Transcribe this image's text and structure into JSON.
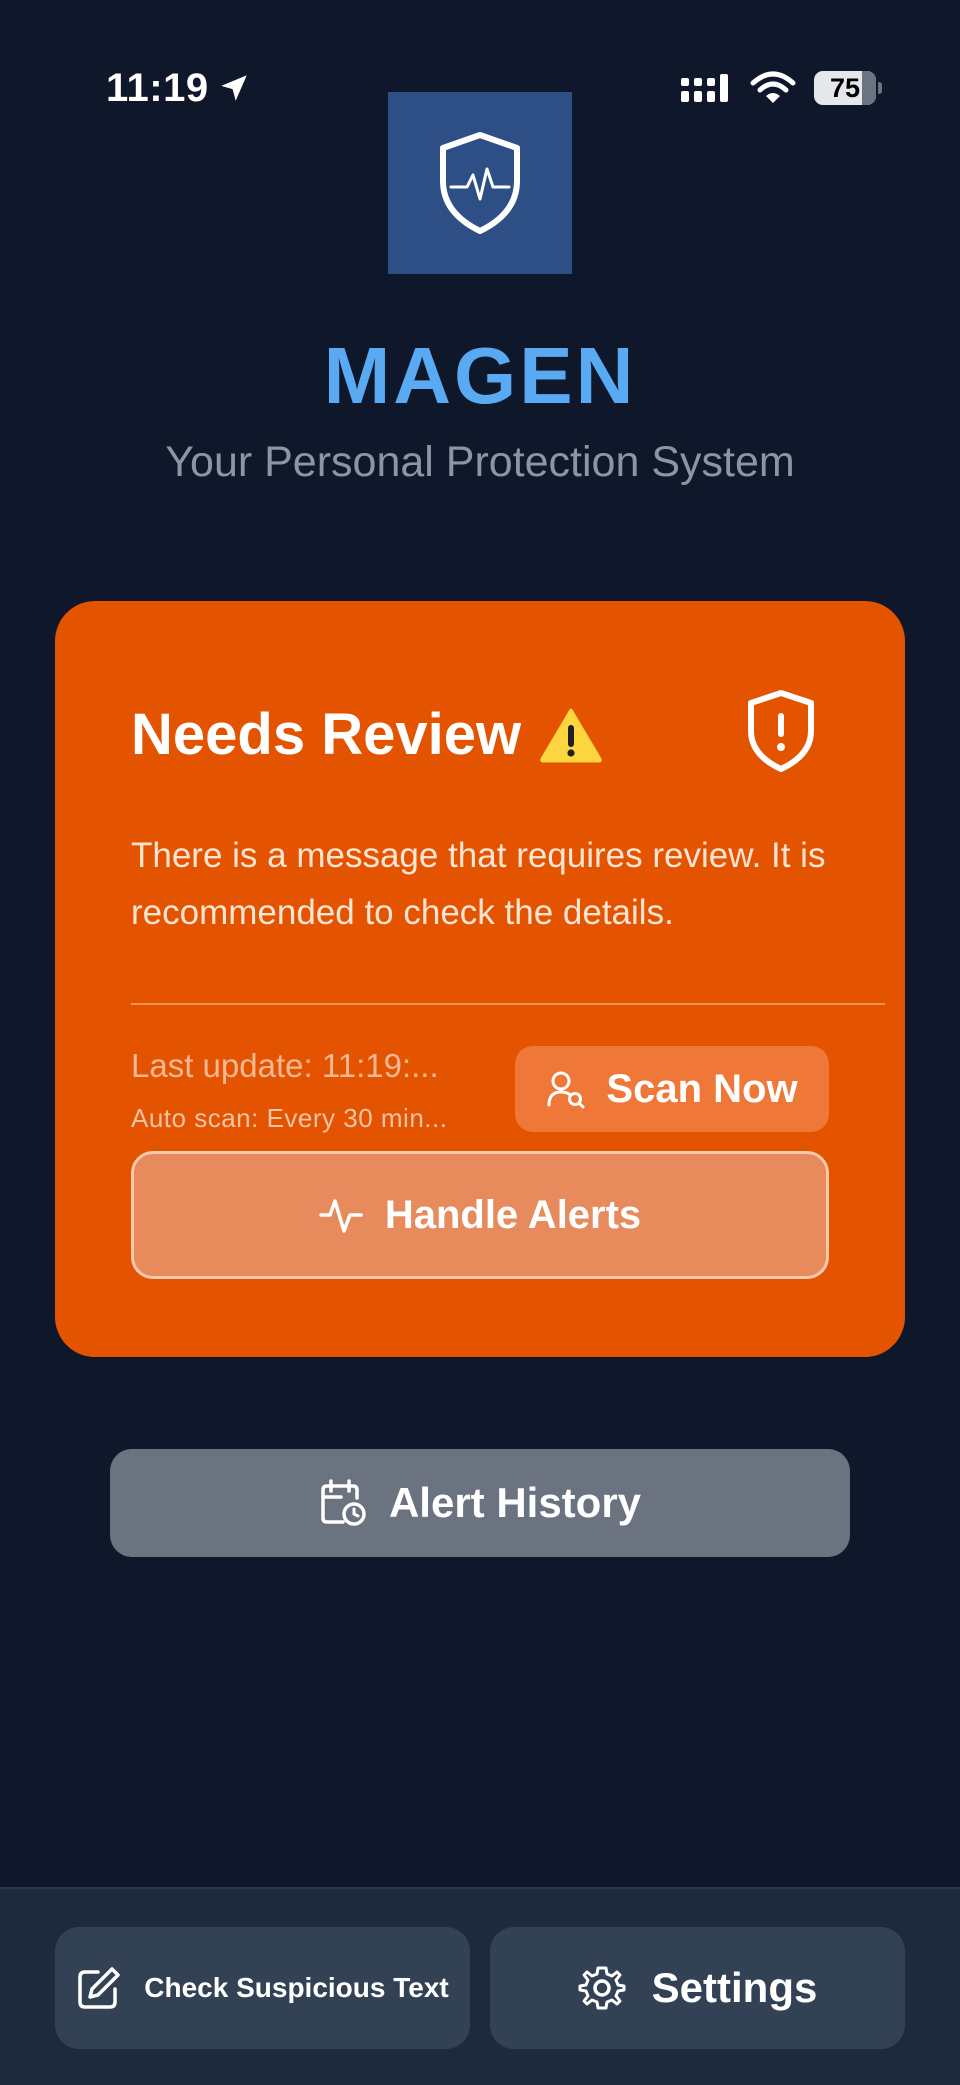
{
  "status_bar": {
    "time": "11:19",
    "battery_level": "75",
    "icons": [
      "location-arrow-icon",
      "cellular-signal-icon",
      "wifi-icon",
      "battery-icon"
    ]
  },
  "header": {
    "logo_icon": "shield-heartbeat-icon",
    "title": "MAGEN",
    "subtitle": "Your Personal Protection System"
  },
  "status_card": {
    "title": "Needs Review",
    "title_emoji": "⚠️",
    "description": "There is a message that requires review. It is recommended to check the details.",
    "last_update": "Last update: 11:19:...",
    "auto_scan": "Auto scan: Every 30 min...",
    "scan_label": "Scan Now",
    "handle_label": "Handle Alerts",
    "colors": {
      "background": "#e35300",
      "scan_button": "#ef7838",
      "handle_button": "#e78a5c"
    }
  },
  "history": {
    "label": "Alert History"
  },
  "bottom_bar": {
    "check_label": "Check Suspicious Text",
    "settings_label": "Settings"
  },
  "colors": {
    "background": "#0f172a",
    "accent": "#5aa9f3",
    "logo_background": "#2d4f86"
  }
}
